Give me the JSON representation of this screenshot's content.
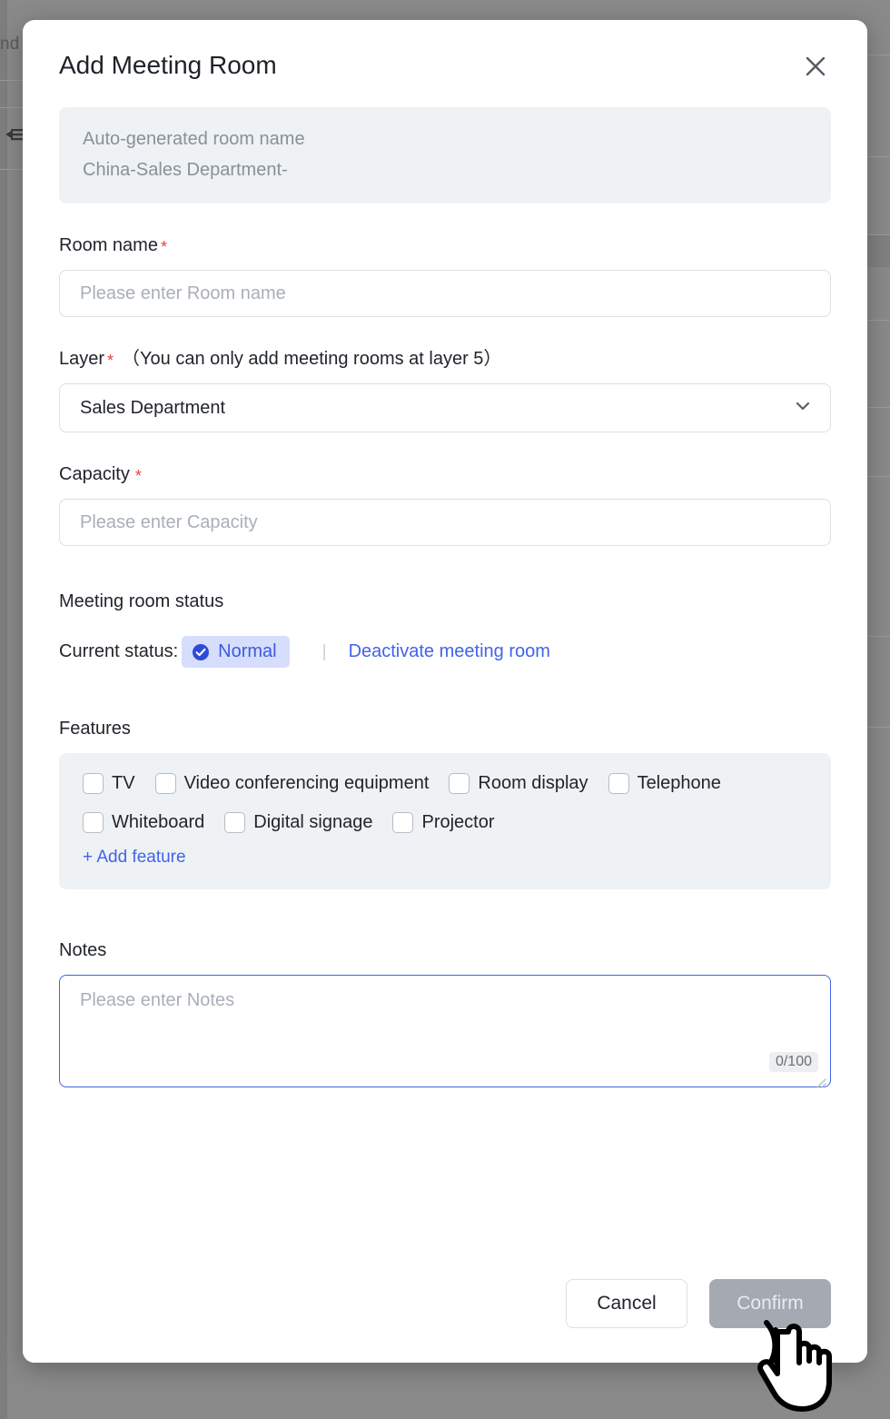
{
  "background": {
    "partial_text": "nd",
    "collapse_icon": "collapse-sidebar-icon"
  },
  "modal": {
    "title": "Add Meeting Room",
    "close_icon": "close-icon",
    "autoname": {
      "line1": "Auto-generated room name",
      "line2": "China-Sales Department-"
    },
    "room_name": {
      "label": "Room name",
      "required_marker": "*",
      "placeholder": "Please enter Room name",
      "value": ""
    },
    "layer": {
      "label": "Layer",
      "required_marker": "*",
      "hint": "（You can only add meeting rooms at layer 5）",
      "selected": "Sales Department",
      "chevron_icon": "chevron-down-icon"
    },
    "capacity": {
      "label": "Capacity",
      "required_marker": "*",
      "placeholder": "Please enter Capacity",
      "value": ""
    },
    "status": {
      "section_label": "Meeting room status",
      "current_label": "Current status:",
      "badge_text": "Normal",
      "badge_icon": "check-circle-icon",
      "badge_bg": "#d7ddfd",
      "badge_color": "#3b5bdb",
      "separator": "|",
      "deactivate_link": "Deactivate meeting room"
    },
    "features": {
      "label": "Features",
      "row1": [
        {
          "label": "TV",
          "checked": false
        },
        {
          "label": "Video conferencing equipment",
          "checked": false
        },
        {
          "label": "Room display",
          "checked": false
        },
        {
          "label": "Telephone",
          "checked": false
        }
      ],
      "row2": [
        {
          "label": "Whiteboard",
          "checked": false
        },
        {
          "label": "Digital signage",
          "checked": false
        },
        {
          "label": "Projector",
          "checked": false
        }
      ],
      "add_link": "+ Add feature"
    },
    "notes": {
      "label": "Notes",
      "placeholder": "Please enter Notes",
      "value": "",
      "counter": "0/100"
    },
    "footer": {
      "cancel_label": "Cancel",
      "confirm_label": "Confirm"
    }
  },
  "accent_color": "#4263eb",
  "required_color": "#e8423f",
  "cursor": {
    "icon": "click-hand-cursor-icon"
  }
}
